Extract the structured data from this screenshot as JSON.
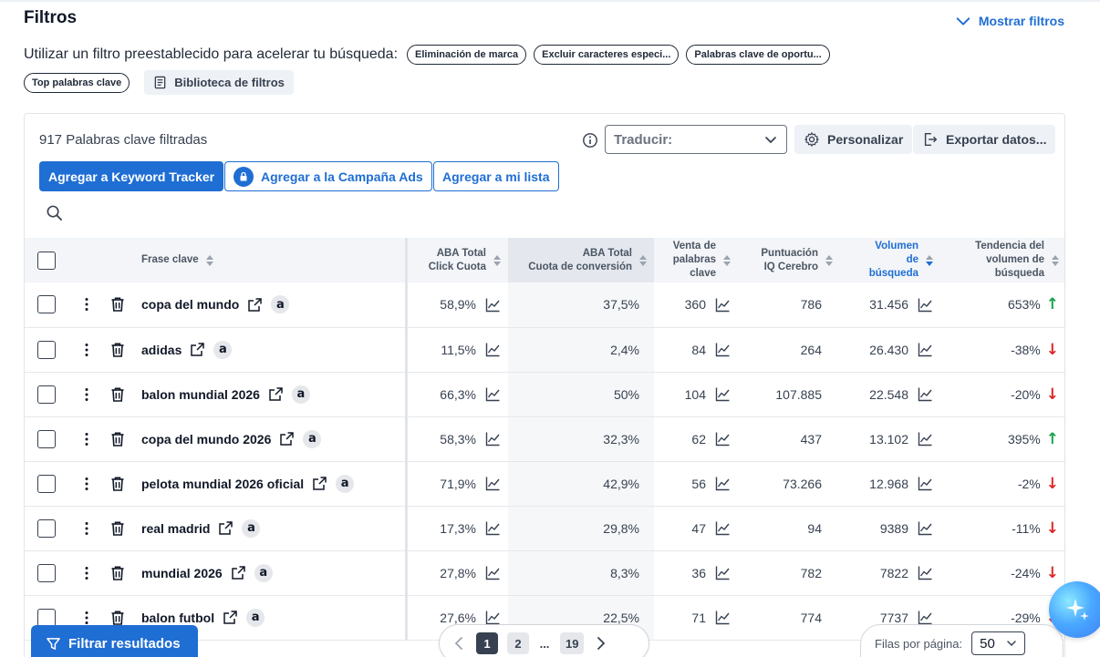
{
  "header": {
    "title": "Filtros",
    "show_filters": "Mostrar filtros"
  },
  "presets": {
    "label": "Utilizar un filtro preestablecido para acelerar tu búsqueda:",
    "chips": [
      "Eliminación de marca",
      "Excluir caracteres especi...",
      "Palabras clave de oportu...",
      "Top palabras clave"
    ],
    "library": "Biblioteca de filtros"
  },
  "toolbar": {
    "count": "917 Palabras clave filtradas",
    "translate_label": "Traducir:",
    "customize": "Personalizar",
    "export": "Exportar datos...",
    "add_tracker": "Agregar a Keyword Tracker",
    "add_campaign": "Agregar a la Campaña Ads",
    "add_list": "Agregar a mi lista"
  },
  "table": {
    "headers": {
      "keyword": "Frase clave",
      "click_share_1": "ABA Total",
      "click_share_2": "Click Cuota",
      "conv_share_1": "ABA Total",
      "conv_share_2": "Cuota de conversión",
      "sales_1": "Venta de",
      "sales_2": "palabras",
      "sales_3": "clave",
      "iq_1": "Puntuación",
      "iq_2": "IQ Cerebro",
      "volume_1": "Volumen",
      "volume_2": "de",
      "volume_3": "búsqueda",
      "trend_1": "Tendencia del",
      "trend_2": "volumen de",
      "trend_3": "búsqueda"
    },
    "rows": [
      {
        "keyword": "copa del mundo",
        "click": "58,9%",
        "conv": "37,5%",
        "sales": "360",
        "iq": "786",
        "volume": "31.456",
        "trend": "653%",
        "dir": "up"
      },
      {
        "keyword": "adidas",
        "click": "11,5%",
        "conv": "2,4%",
        "sales": "84",
        "iq": "264",
        "volume": "26.430",
        "trend": "-38%",
        "dir": "down"
      },
      {
        "keyword": "balon mundial 2026",
        "click": "66,3%",
        "conv": "50%",
        "sales": "104",
        "iq": "107.885",
        "volume": "22.548",
        "trend": "-20%",
        "dir": "down"
      },
      {
        "keyword": "copa del mundo 2026",
        "click": "58,3%",
        "conv": "32,3%",
        "sales": "62",
        "iq": "437",
        "volume": "13.102",
        "trend": "395%",
        "dir": "up"
      },
      {
        "keyword": "pelota mundial 2026 oficial",
        "click": "71,9%",
        "conv": "42,9%",
        "sales": "56",
        "iq": "73.266",
        "volume": "12.968",
        "trend": "-2%",
        "dir": "down"
      },
      {
        "keyword": "real madrid",
        "click": "17,3%",
        "conv": "29,8%",
        "sales": "47",
        "iq": "94",
        "volume": "9389",
        "trend": "-11%",
        "dir": "down"
      },
      {
        "keyword": "mundial 2026",
        "click": "27,8%",
        "conv": "8,3%",
        "sales": "36",
        "iq": "782",
        "volume": "7822",
        "trend": "-24%",
        "dir": "down"
      },
      {
        "keyword": "balon futbol",
        "click": "27,6%",
        "conv": "22,5%",
        "sales": "71",
        "iq": "774",
        "volume": "7737",
        "trend": "-29%",
        "dir": "down"
      }
    ]
  },
  "footer": {
    "filter_results": "Filtrar resultados",
    "pages": [
      "1",
      "2",
      "...",
      "19"
    ],
    "rows_label": "Filas por página:",
    "rows_value": "50"
  },
  "icons": {
    "amazon_glyph": "a",
    "arrow_up": "↑",
    "arrow_down": "↓"
  }
}
